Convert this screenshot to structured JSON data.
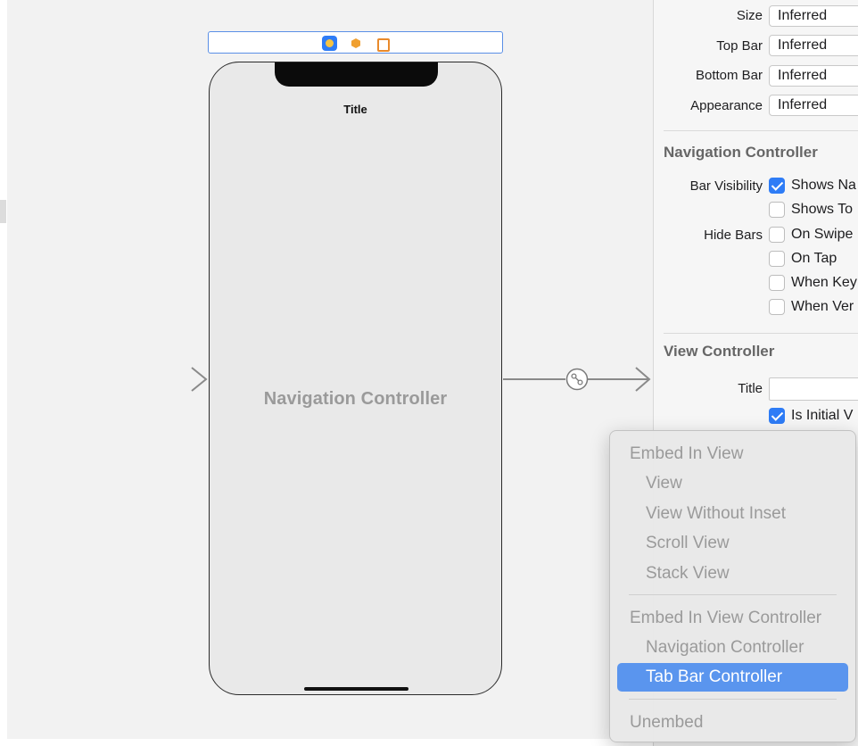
{
  "scene": {
    "nav_bar_title": "Title",
    "controller_label": "Navigation Controller"
  },
  "inspector": {
    "simulated_metrics": [
      {
        "label": "Size",
        "value": "Inferred"
      },
      {
        "label": "Top Bar",
        "value": "Inferred"
      },
      {
        "label": "Bottom Bar",
        "value": "Inferred"
      },
      {
        "label": "Appearance",
        "value": "Inferred"
      }
    ],
    "navigation_controller": {
      "header": "Navigation Controller",
      "bar_visibility_label": "Bar Visibility",
      "hide_bars_label": "Hide Bars",
      "options": [
        {
          "label": "Shows Na",
          "checked": true
        },
        {
          "label": "Shows To",
          "checked": false
        },
        {
          "label": "On Swipe",
          "checked": false
        },
        {
          "label": "On Tap",
          "checked": false
        },
        {
          "label": "When Key",
          "checked": false
        },
        {
          "label": "When Ver",
          "checked": false
        }
      ]
    },
    "view_controller": {
      "header": "View Controller",
      "title_label": "Title",
      "title_value": "",
      "is_initial_label": "Is Initial V",
      "is_initial_checked": true
    }
  },
  "context_menu": {
    "embed_in_view": "Embed In View",
    "view": "View",
    "view_without_inset": "View Without Inset",
    "scroll_view": "Scroll View",
    "stack_view": "Stack View",
    "embed_in_view_controller": "Embed In View Controller",
    "navigation_controller": "Navigation Controller",
    "tab_bar_controller": "Tab Bar Controller",
    "unembed": "Unembed"
  },
  "colors": {
    "accent": "#2e7cf6",
    "menu_highlight": "#5a95ee",
    "canvas": "#f2f2f2"
  }
}
